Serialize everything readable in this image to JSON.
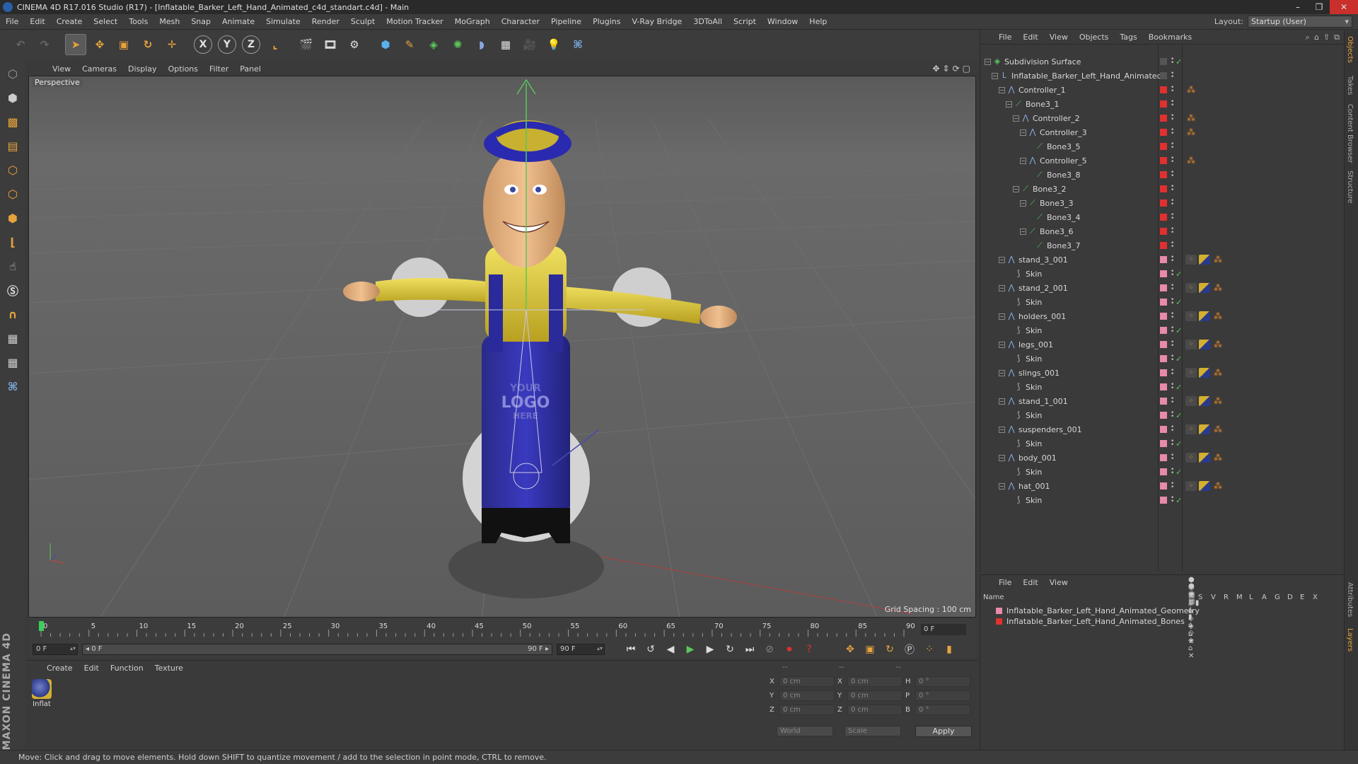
{
  "window": {
    "title": "CINEMA 4D R17.016 Studio (R17) - [Inflatable_Barker_Left_Hand_Animated_c4d_standart.c4d] - Main",
    "controls": [
      "–",
      "❐",
      "✕"
    ]
  },
  "menubar": {
    "items": [
      "File",
      "Edit",
      "Create",
      "Select",
      "Tools",
      "Mesh",
      "Snap",
      "Animate",
      "Simulate",
      "Render",
      "Sculpt",
      "Motion Tracker",
      "MoGraph",
      "Character",
      "Pipeline",
      "Plugins",
      "V-Ray Bridge",
      "3DToAll",
      "Script",
      "Window",
      "Help"
    ],
    "layout_label": "Layout:",
    "layout_value": "Startup (User)"
  },
  "toolbar": {
    "axis_x": "X",
    "axis_y": "Y",
    "axis_z": "Z"
  },
  "viewport": {
    "menu": [
      "View",
      "Cameras",
      "Display",
      "Options",
      "Filter",
      "Panel"
    ],
    "label": "Perspective",
    "grid_spacing": "Grid Spacing : 100 cm",
    "logo_lines": [
      "YOUR",
      "LOGO",
      "HERE"
    ]
  },
  "timeline": {
    "ticks": [
      "0",
      "5",
      "10",
      "15",
      "20",
      "25",
      "30",
      "35",
      "40",
      "45",
      "50",
      "55",
      "60",
      "65",
      "70",
      "75",
      "80",
      "85",
      "90"
    ],
    "frame_end_field": "0 F",
    "start_field": "0 F",
    "range_start": "◂ 0 F",
    "range_end": "90 F ▸",
    "end_field": "90 F"
  },
  "material_manager": {
    "menu": [
      "Create",
      "Edit",
      "Function",
      "Texture"
    ],
    "material_name": "Inflat"
  },
  "coordinates": {
    "header": [
      "--",
      "--",
      "--"
    ],
    "rows": [
      {
        "a": "X",
        "av": "0 cm",
        "b": "X",
        "bv": "0 cm",
        "c": "H",
        "cv": "0 °"
      },
      {
        "a": "Y",
        "av": "0 cm",
        "b": "Y",
        "bv": "0 cm",
        "c": "P",
        "cv": "0 °"
      },
      {
        "a": "Z",
        "av": "0 cm",
        "b": "Z",
        "bv": "0 cm",
        "c": "B",
        "cv": "0 °"
      }
    ],
    "mode_world": "World",
    "mode_scale": "Scale",
    "apply": "Apply"
  },
  "status": {
    "text": "Move: Click and drag to move elements. Hold down SHIFT to quantize movement / add to the selection in point mode, CTRL to remove."
  },
  "object_manager": {
    "menu": [
      "File",
      "Edit",
      "View",
      "Objects",
      "Tags",
      "Bookmarks"
    ],
    "objects": [
      {
        "name": "Subdivision Surface",
        "type": "subdiv",
        "swatch": "#555555"
      },
      {
        "name": "Inflatable_Barker_Left_Hand_Animated",
        "type": "null",
        "swatch": "#555555"
      },
      {
        "name": "Controller_1",
        "type": "joint",
        "swatch": "#e03030"
      },
      {
        "name": "Bone3_1",
        "type": "bone",
        "swatch": "#e03030"
      },
      {
        "name": "Controller_2",
        "type": "joint",
        "swatch": "#e03030"
      },
      {
        "name": "Controller_3",
        "type": "joint",
        "swatch": "#e03030"
      },
      {
        "name": "Bone3_5",
        "type": "bone",
        "swatch": "#e03030"
      },
      {
        "name": "Controller_5",
        "type": "joint",
        "swatch": "#e03030"
      },
      {
        "name": "Bone3_8",
        "type": "bone",
        "swatch": "#e03030"
      },
      {
        "name": "Bone3_2",
        "type": "bone",
        "swatch": "#e03030"
      },
      {
        "name": "Bone3_3",
        "type": "bone",
        "swatch": "#e03030"
      },
      {
        "name": "Bone3_4",
        "type": "bone",
        "swatch": "#e03030"
      },
      {
        "name": "Bone3_6",
        "type": "bone",
        "swatch": "#e03030"
      },
      {
        "name": "Bone3_7",
        "type": "bone",
        "swatch": "#e03030"
      },
      {
        "name": "stand_3_001",
        "type": "joint",
        "swatch": "#e88aa8"
      },
      {
        "name": "Skin",
        "type": "skin",
        "swatch": "#e88aa8"
      },
      {
        "name": "stand_2_001",
        "type": "joint",
        "swatch": "#e88aa8"
      },
      {
        "name": "Skin",
        "type": "skin",
        "swatch": "#e88aa8"
      },
      {
        "name": "holders_001",
        "type": "joint",
        "swatch": "#e88aa8"
      },
      {
        "name": "Skin",
        "type": "skin",
        "swatch": "#e88aa8"
      },
      {
        "name": "legs_001",
        "type": "joint",
        "swatch": "#e88aa8"
      },
      {
        "name": "Skin",
        "type": "skin",
        "swatch": "#e88aa8"
      },
      {
        "name": "slings_001",
        "type": "joint",
        "swatch": "#e88aa8"
      },
      {
        "name": "Skin",
        "type": "skin",
        "swatch": "#e88aa8"
      },
      {
        "name": "stand_1_001",
        "type": "joint",
        "swatch": "#e88aa8"
      },
      {
        "name": "Skin",
        "type": "skin",
        "swatch": "#e88aa8"
      },
      {
        "name": "suspenders_001",
        "type": "joint",
        "swatch": "#e88aa8"
      },
      {
        "name": "Skin",
        "type": "skin",
        "swatch": "#e88aa8"
      },
      {
        "name": "body_001",
        "type": "joint",
        "swatch": "#e88aa8"
      },
      {
        "name": "Skin",
        "type": "skin",
        "swatch": "#e88aa8"
      },
      {
        "name": "hat_001",
        "type": "joint",
        "swatch": "#e88aa8"
      },
      {
        "name": "Skin",
        "type": "skin",
        "swatch": "#e88aa8"
      }
    ]
  },
  "layer_manager": {
    "menu": [
      "File",
      "Edit",
      "View"
    ],
    "columns": [
      "Name",
      "S",
      "V",
      "R",
      "M",
      "L",
      "A",
      "G",
      "D",
      "E",
      "X"
    ],
    "layers": [
      {
        "name": "Inflatable_Barker_Left_Hand_Animated_Geometry",
        "color": "#e88aa8"
      },
      {
        "name": "Inflatable_Barker_Left_Hand_Animated_Bones",
        "color": "#e03030"
      }
    ]
  },
  "side_tabs": [
    "Objects",
    "Takes",
    "Content Browser",
    "Structure",
    "Attributes",
    "Layers"
  ]
}
